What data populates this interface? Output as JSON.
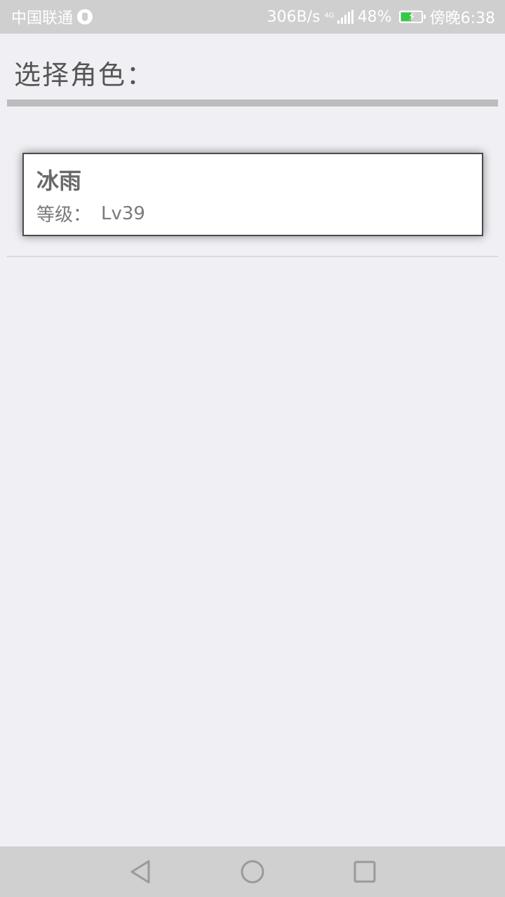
{
  "status_bar": {
    "carrier": "中国联通",
    "speed": "306B/s",
    "network": "4G",
    "battery": "48%",
    "time": "傍晚6:38",
    "icons": [
      "carrier-icon",
      "signal-icon",
      "battery-icon"
    ]
  },
  "header": {
    "title": "选择角色："
  },
  "roles": [
    {
      "name": "冰雨",
      "level_label": "等级：",
      "level_value": "Lv39"
    }
  ],
  "nav_bar": {
    "icons": [
      "back-icon",
      "home-icon",
      "recent-apps-icon"
    ]
  },
  "colors": {
    "background": "#efeff4",
    "status_bar": "#cfcfcf",
    "nav_bar": "#d0d0d0",
    "battery_fill": "#2ecc40",
    "divider": "#bcbcbe"
  }
}
